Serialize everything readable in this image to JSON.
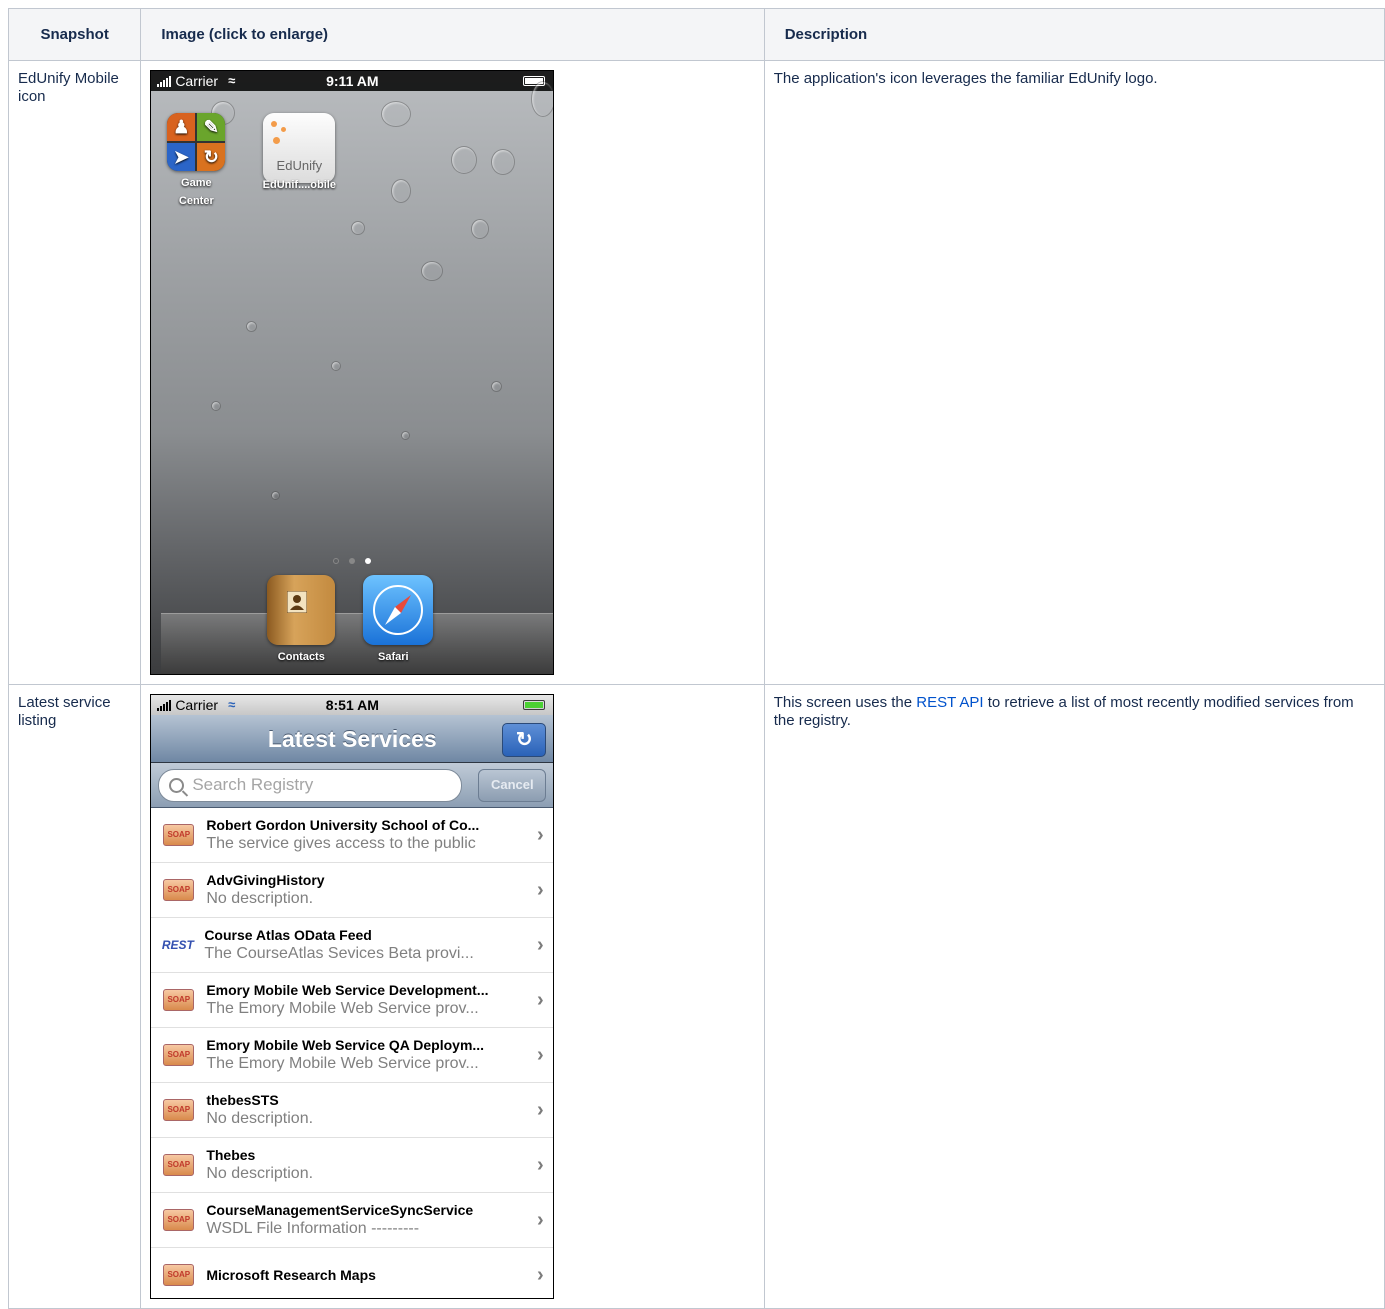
{
  "headers": {
    "snapshot": "Snapshot",
    "image": "Image (click to enlarge)",
    "description": "Description"
  },
  "rows": [
    {
      "snapshot": "EdUnify Mobile icon",
      "description": "The application's icon leverages the familiar EdUnify logo."
    },
    {
      "snapshot": "Latest service listing",
      "description_before": "This screen uses the ",
      "description_link": "REST API",
      "description_after": " to retrieve a list of most recently modified services from the registry."
    }
  ],
  "phone1": {
    "carrier": "Carrier",
    "time": "9:11 AM",
    "apps": [
      {
        "label": "Game Center",
        "icon": "game-center-icon"
      },
      {
        "label": "EdUnif....obile",
        "icon": "edunify-icon",
        "icon_text": "EdUnify"
      }
    ],
    "dock": [
      {
        "label": "Contacts",
        "icon": "contacts-icon"
      },
      {
        "label": "Safari",
        "icon": "safari-icon"
      }
    ]
  },
  "phone2": {
    "carrier": "Carrier",
    "time": "8:51 AM",
    "nav_title": "Latest Services",
    "search_placeholder": "Search Registry",
    "cancel_label": "Cancel",
    "services": [
      {
        "type": "SOAP",
        "title": "Robert Gordon University School of Co...",
        "subtitle": "The service gives access to the public"
      },
      {
        "type": "SOAP",
        "title": "AdvGivingHistory",
        "subtitle": "No description."
      },
      {
        "type": "REST",
        "title": "Course Atlas OData Feed",
        "subtitle": "The CourseAtlas Sevices Beta provi..."
      },
      {
        "type": "SOAP",
        "title": "Emory Mobile Web Service Development...",
        "subtitle": "The Emory Mobile Web Service prov..."
      },
      {
        "type": "SOAP",
        "title": "Emory Mobile Web Service QA Deploym...",
        "subtitle": "The Emory Mobile Web Service prov..."
      },
      {
        "type": "SOAP",
        "title": "thebesSTS",
        "subtitle": "No description."
      },
      {
        "type": "SOAP",
        "title": "Thebes",
        "subtitle": "No description."
      },
      {
        "type": "SOAP",
        "title": "CourseManagementServiceSyncService",
        "subtitle": "WSDL File Information          ---------"
      },
      {
        "type": "SOAP",
        "title": "Microsoft Research Maps",
        "subtitle": ""
      }
    ]
  }
}
